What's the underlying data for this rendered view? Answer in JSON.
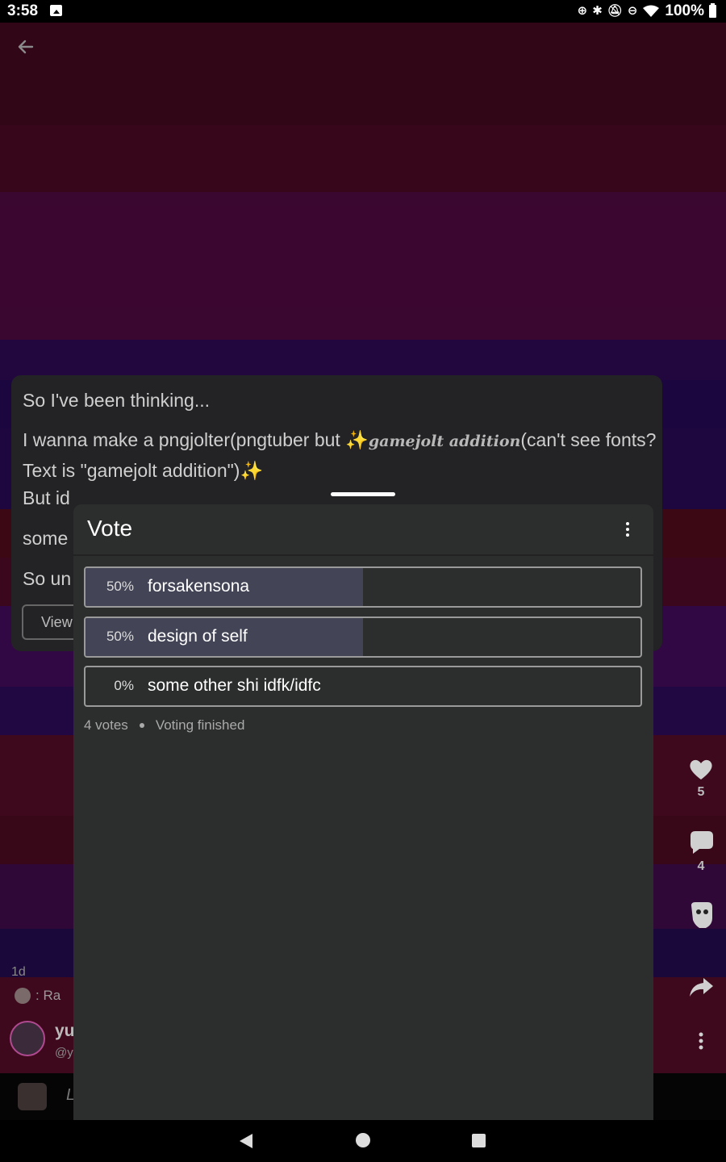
{
  "status_bar": {
    "time": "3:58",
    "battery": "100%",
    "icons": [
      "sync-icon",
      "bluetooth-icon",
      "notifications-off-icon",
      "dnd-icon",
      "wifi-icon",
      "battery-icon"
    ]
  },
  "background": {
    "stripe_colors": [
      "#6e0f33",
      "#7a0f3c",
      "#82106a",
      "#4d0f8a",
      "#3f0f8c",
      "#40108a",
      "#86122e",
      "#80103e",
      "#6e1394",
      "#4a1394",
      "#8a1340",
      "#7c1238",
      "#6a127a",
      "#3d1282",
      "#8a1440"
    ]
  },
  "post": {
    "line1": "So I've been thinking...",
    "line2_start": "I wanna make a pngjolter(pngtuber but ",
    "line2_fancy": "gamejolt addition",
    "line2_end": "(can't see fonts? Text is \"gamejolt addition\")",
    "line3": "But id",
    "line4": "some",
    "line5": "So un",
    "view_label": "View",
    "age": "1d",
    "tag_text": ": Ra",
    "author_name": "yu",
    "author_handle": "@y",
    "comment_placeholder": "L"
  },
  "rail": {
    "likes": "5",
    "comments": "4"
  },
  "vote": {
    "title": "Vote",
    "options": [
      {
        "percent_label": "50%",
        "label": "forsakensona",
        "fraction": 0.5
      },
      {
        "percent_label": "50%",
        "label": "design of self",
        "fraction": 0.5
      },
      {
        "percent_label": "0%",
        "label": "some other shi idfk/idfc",
        "fraction": 0.0
      }
    ],
    "votes": "4 votes",
    "status": "Voting finished"
  },
  "colors": {
    "sheet_bg": "#2c2d2d",
    "result_fill": "#434557",
    "sparkle": "#d9b640"
  }
}
